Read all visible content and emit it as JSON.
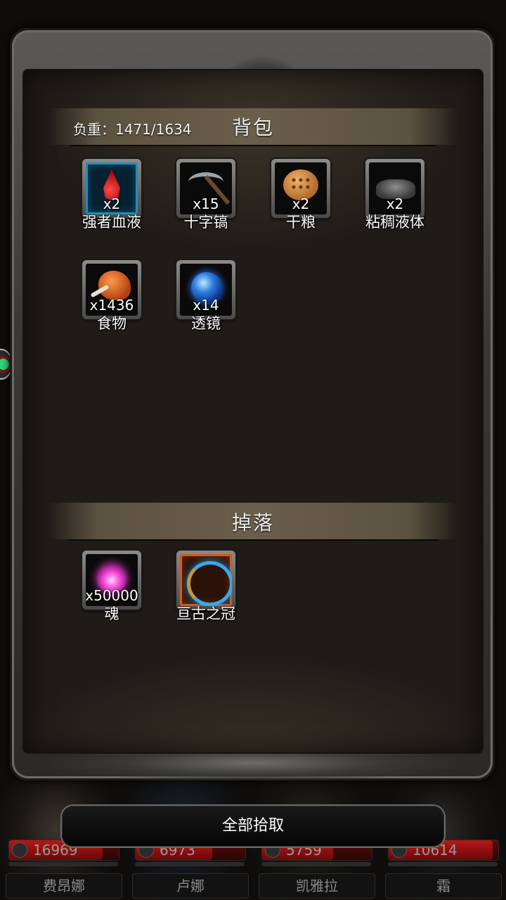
{
  "header": {
    "weight_label": "负重：1471/1634",
    "backpack_title": "背包",
    "drop_title": "掉落"
  },
  "backpack_items": [
    {
      "name": "强者血液",
      "count": "x2",
      "icon": "blood-drop-icon"
    },
    {
      "name": "十字镐",
      "count": "x15",
      "icon": "pickaxe-icon"
    },
    {
      "name": "干粮",
      "count": "x2",
      "icon": "dry-ration-icon"
    },
    {
      "name": "粘稠液体",
      "count": "x2",
      "icon": "viscous-liquid-icon"
    },
    {
      "name": "食物",
      "count": "x1436",
      "icon": "meat-icon"
    },
    {
      "name": "透镜",
      "count": "x14",
      "icon": "lens-orb-icon"
    }
  ],
  "drop_items": [
    {
      "name": "魂",
      "count": "x50000",
      "icon": "soul-orb-icon"
    },
    {
      "name": "亘古之冠",
      "count": "",
      "icon": "ancient-crown-icon"
    }
  ],
  "pickup_button": "全部拾取",
  "party": [
    {
      "name": "费昂娜",
      "hp": "16969",
      "hp_fill": 0.85
    },
    {
      "name": "卢娜",
      "hp": "6973",
      "hp_fill": 0.7
    },
    {
      "name": "凯雅拉",
      "hp": "5759",
      "hp_fill": 0.65
    },
    {
      "name": "霜",
      "hp": "10614",
      "hp_fill": 0.95
    }
  ],
  "colors": {
    "rare_blue": "#1f8fb8",
    "epic_orange": "#d35a22",
    "hp_red": "#b51818"
  }
}
